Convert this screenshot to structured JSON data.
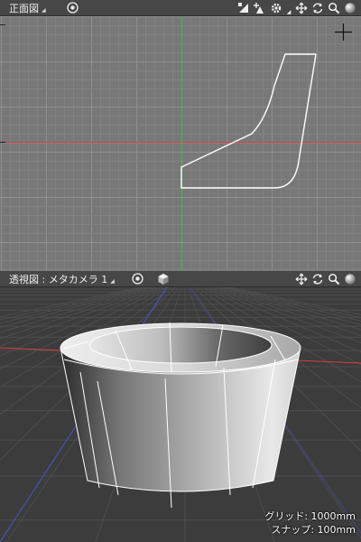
{
  "front_view": {
    "title": "正面図",
    "icons": [
      "target-icon",
      "vertex-edit-icon",
      "add-shape-icon",
      "gear-icon",
      "move-icon",
      "rotate-icon",
      "zoom-icon",
      "shading-sphere-icon"
    ]
  },
  "perspective_view": {
    "title": "透視図 : メタカメラ 1",
    "icons": [
      "target-icon",
      "cube-icon",
      "move-icon",
      "rotate-icon",
      "zoom-icon",
      "shading-sphere-icon"
    ],
    "grid_label": "グリッド: 1000mm",
    "snap_label": "スナップ: 100mm"
  },
  "colors": {
    "x_axis": "#d94040",
    "y_axis": "#3fbf4a",
    "z_axis": "#4a55d0",
    "outline": "#ffffff",
    "front_bg": "#787878",
    "persp_bg": "#3c3c3c"
  }
}
